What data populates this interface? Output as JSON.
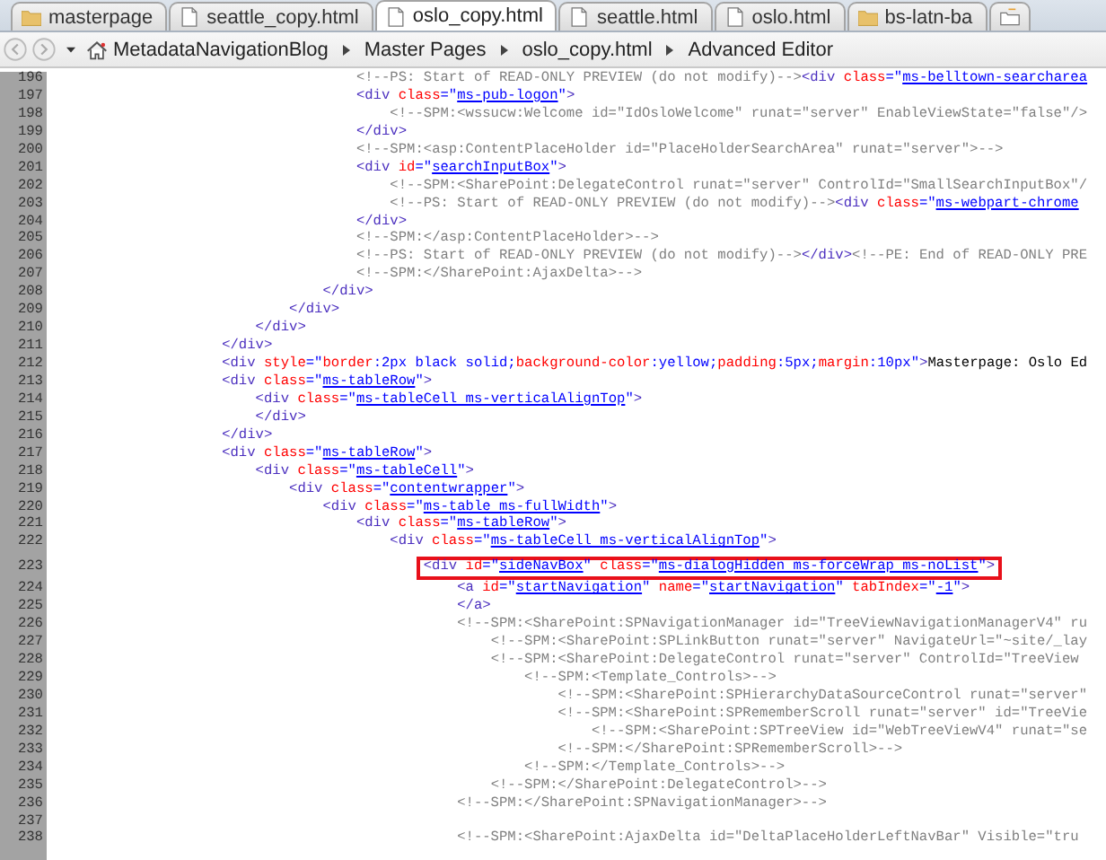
{
  "tabs": [
    {
      "label": "masterpage",
      "kind": "folder",
      "selected": false
    },
    {
      "label": "seattle_copy.html",
      "kind": "file",
      "selected": false
    },
    {
      "label": "oslo_copy.html",
      "kind": "file",
      "selected": true
    },
    {
      "label": "seattle.html",
      "kind": "file",
      "selected": false
    },
    {
      "label": "oslo.html",
      "kind": "file",
      "selected": false
    },
    {
      "label": "bs-latn-ba",
      "kind": "folder",
      "selected": false
    }
  ],
  "breadcrumb": [
    "MetadataNavigationBlog",
    "Master Pages",
    "oslo_copy.html",
    "Advanced Editor"
  ],
  "lines": [
    {
      "n": "196",
      "boxed": false,
      "code": [
        {
          "kind": "comment",
          "t": "                                    <!--PS: Start of READ-ONLY PREVIEW (do not modify)-->"
        },
        {
          "kind": "tag",
          "t": "<div"
        },
        {
          "kind": "attr",
          "t": " class"
        },
        {
          "kind": "punct",
          "t": "=\""
        },
        {
          "kind": "value",
          "t": "ms-belltown-searcharea"
        }
      ]
    },
    {
      "n": "197",
      "boxed": false,
      "code": [
        {
          "kind": "tag",
          "t": "                                    <div"
        },
        {
          "kind": "attr",
          "t": " class"
        },
        {
          "kind": "punct",
          "t": "=\""
        },
        {
          "kind": "value",
          "t": "ms-pub-logon"
        },
        {
          "kind": "punct",
          "t": "\""
        },
        {
          "kind": "tag",
          "t": ">"
        }
      ]
    },
    {
      "n": "198",
      "boxed": false,
      "code": [
        {
          "kind": "comment",
          "t": "                                        <!--SPM:<wssucw:Welcome id=\"IdOsloWelcome\" runat=\"server\" EnableViewState=\"false\"/>"
        }
      ]
    },
    {
      "n": "199",
      "boxed": false,
      "code": [
        {
          "kind": "tag",
          "t": "                                    </div>"
        }
      ]
    },
    {
      "n": "200",
      "boxed": false,
      "code": [
        {
          "kind": "comment",
          "t": "                                    <!--SPM:<asp:ContentPlaceHolder id=\"PlaceHolderSearchArea\" runat=\"server\">-->"
        }
      ]
    },
    {
      "n": "201",
      "boxed": false,
      "code": [
        {
          "kind": "tag",
          "t": "                                    <div"
        },
        {
          "kind": "attr",
          "t": " id"
        },
        {
          "kind": "punct",
          "t": "=\""
        },
        {
          "kind": "value",
          "t": "searchInputBox"
        },
        {
          "kind": "punct",
          "t": "\""
        },
        {
          "kind": "tag",
          "t": ">"
        }
      ]
    },
    {
      "n": "202",
      "boxed": false,
      "code": [
        {
          "kind": "comment",
          "t": "                                        <!--SPM:<SharePoint:DelegateControl runat=\"server\" ControlId=\"SmallSearchInputBox\"/"
        }
      ]
    },
    {
      "n": "203",
      "boxed": false,
      "code": [
        {
          "kind": "comment",
          "t": "                                        <!--PS: Start of READ-ONLY PREVIEW (do not modify)-->"
        },
        {
          "kind": "tag",
          "t": "<div"
        },
        {
          "kind": "attr",
          "t": " class"
        },
        {
          "kind": "punct",
          "t": "=\""
        },
        {
          "kind": "value",
          "t": "ms-webpart-chrome"
        }
      ]
    },
    {
      "n": "204",
      "boxed": false,
      "code": [
        {
          "kind": "tag",
          "t": "                                    </div>"
        }
      ]
    },
    {
      "n": "205",
      "boxed": false,
      "code": [
        {
          "kind": "comment",
          "t": "                                    <!--SPM:</asp:ContentPlaceHolder>-->"
        }
      ]
    },
    {
      "n": "206",
      "boxed": false,
      "code": [
        {
          "kind": "comment",
          "t": "                                    <!--PS: Start of READ-ONLY PREVIEW (do not modify)-->"
        },
        {
          "kind": "tag",
          "t": "</div>"
        },
        {
          "kind": "comment",
          "t": "<!--PE: End of READ-ONLY PRE"
        }
      ]
    },
    {
      "n": "207",
      "boxed": false,
      "code": [
        {
          "kind": "comment",
          "t": "                                    <!--SPM:</SharePoint:AjaxDelta>-->"
        }
      ]
    },
    {
      "n": "208",
      "boxed": false,
      "code": [
        {
          "kind": "tag",
          "t": "                                </div>"
        }
      ]
    },
    {
      "n": "209",
      "boxed": false,
      "code": [
        {
          "kind": "tag",
          "t": "                            </div>"
        }
      ]
    },
    {
      "n": "210",
      "boxed": false,
      "code": [
        {
          "kind": "tag",
          "t": "                        </div>"
        }
      ]
    },
    {
      "n": "211",
      "boxed": false,
      "code": [
        {
          "kind": "tag",
          "t": "                    </div>"
        }
      ]
    },
    {
      "n": "212",
      "boxed": false,
      "code": [
        {
          "kind": "tag",
          "t": "                    <div"
        },
        {
          "kind": "attr",
          "t": " style"
        },
        {
          "kind": "punct",
          "t": "=\""
        },
        {
          "kind": "property",
          "t": "border"
        },
        {
          "kind": "css",
          "t": ":2px black solid;"
        },
        {
          "kind": "property",
          "t": "background-color"
        },
        {
          "kind": "css",
          "t": ":yellow;"
        },
        {
          "kind": "property",
          "t": "padding"
        },
        {
          "kind": "css",
          "t": ":5px;"
        },
        {
          "kind": "property",
          "t": "margin"
        },
        {
          "kind": "css",
          "t": ":10px"
        },
        {
          "kind": "punct",
          "t": "\""
        },
        {
          "kind": "tag",
          "t": ">"
        },
        {
          "kind": "text",
          "t": "Masterpage: Oslo Ed"
        }
      ]
    },
    {
      "n": "213",
      "boxed": false,
      "code": [
        {
          "kind": "tag",
          "t": "                    <div"
        },
        {
          "kind": "attr",
          "t": " class"
        },
        {
          "kind": "punct",
          "t": "=\""
        },
        {
          "kind": "value",
          "t": "ms-tableRow"
        },
        {
          "kind": "punct",
          "t": "\""
        },
        {
          "kind": "tag",
          "t": ">"
        }
      ]
    },
    {
      "n": "214",
      "boxed": false,
      "code": [
        {
          "kind": "tag",
          "t": "                        <div"
        },
        {
          "kind": "attr",
          "t": " class"
        },
        {
          "kind": "punct",
          "t": "=\""
        },
        {
          "kind": "value",
          "t": "ms-tableCell ms-verticalAlignTop"
        },
        {
          "kind": "punct",
          "t": "\""
        },
        {
          "kind": "tag",
          "t": ">"
        }
      ]
    },
    {
      "n": "215",
      "boxed": false,
      "code": [
        {
          "kind": "tag",
          "t": "                        </div>"
        }
      ]
    },
    {
      "n": "216",
      "boxed": false,
      "code": [
        {
          "kind": "tag",
          "t": "                    </div>"
        }
      ]
    },
    {
      "n": "217",
      "boxed": false,
      "code": [
        {
          "kind": "tag",
          "t": "                    <div"
        },
        {
          "kind": "attr",
          "t": " class"
        },
        {
          "kind": "punct",
          "t": "=\""
        },
        {
          "kind": "value",
          "t": "ms-tableRow"
        },
        {
          "kind": "punct",
          "t": "\""
        },
        {
          "kind": "tag",
          "t": ">"
        }
      ]
    },
    {
      "n": "218",
      "boxed": false,
      "code": [
        {
          "kind": "tag",
          "t": "                        <div"
        },
        {
          "kind": "attr",
          "t": " class"
        },
        {
          "kind": "punct",
          "t": "=\""
        },
        {
          "kind": "value",
          "t": "ms-tableCell"
        },
        {
          "kind": "punct",
          "t": "\""
        },
        {
          "kind": "tag",
          "t": ">"
        }
      ]
    },
    {
      "n": "219",
      "boxed": false,
      "code": [
        {
          "kind": "tag",
          "t": "                            <div"
        },
        {
          "kind": "attr",
          "t": " class"
        },
        {
          "kind": "punct",
          "t": "=\""
        },
        {
          "kind": "value",
          "t": "contentwrapper"
        },
        {
          "kind": "punct",
          "t": "\""
        },
        {
          "kind": "tag",
          "t": ">"
        }
      ]
    },
    {
      "n": "220",
      "boxed": false,
      "code": [
        {
          "kind": "tag",
          "t": "                                <div"
        },
        {
          "kind": "attr",
          "t": " class"
        },
        {
          "kind": "punct",
          "t": "=\""
        },
        {
          "kind": "value",
          "t": "ms-table ms-fullWidth"
        },
        {
          "kind": "punct",
          "t": "\""
        },
        {
          "kind": "tag",
          "t": ">"
        }
      ]
    },
    {
      "n": "221",
      "boxed": false,
      "code": [
        {
          "kind": "tag",
          "t": "                                    <div"
        },
        {
          "kind": "attr",
          "t": " class"
        },
        {
          "kind": "punct",
          "t": "=\""
        },
        {
          "kind": "value",
          "t": "ms-tableRow"
        },
        {
          "kind": "punct",
          "t": "\""
        },
        {
          "kind": "tag",
          "t": ">"
        }
      ]
    },
    {
      "n": "222",
      "boxed": false,
      "code": [
        {
          "kind": "tag",
          "t": "                                        <div"
        },
        {
          "kind": "attr",
          "t": " class"
        },
        {
          "kind": "punct",
          "t": "=\""
        },
        {
          "kind": "value",
          "t": "ms-tableCell ms-verticalAlignTop"
        },
        {
          "kind": "punct",
          "t": "\""
        },
        {
          "kind": "tag",
          "t": ">"
        }
      ]
    },
    {
      "n": "223",
      "boxed": true,
      "code": [
        {
          "kind": "tag",
          "t": "                                            <div"
        },
        {
          "kind": "attr",
          "t": " id"
        },
        {
          "kind": "punct",
          "t": "=\""
        },
        {
          "kind": "value",
          "t": "sideNavBox"
        },
        {
          "kind": "punct",
          "t": "\""
        },
        {
          "kind": "attr",
          "t": " class"
        },
        {
          "kind": "punct",
          "t": "=\""
        },
        {
          "kind": "value",
          "t": "ms-dialogHidden ms-forceWrap ms-noList"
        },
        {
          "kind": "punct",
          "t": "\""
        },
        {
          "kind": "tag",
          "t": ">"
        }
      ]
    },
    {
      "n": "224",
      "boxed": false,
      "code": [
        {
          "kind": "tag",
          "t": "                                                <a"
        },
        {
          "kind": "attr",
          "t": " id"
        },
        {
          "kind": "punct",
          "t": "=\""
        },
        {
          "kind": "value",
          "t": "startNavigation"
        },
        {
          "kind": "punct",
          "t": "\""
        },
        {
          "kind": "attr",
          "t": " name"
        },
        {
          "kind": "punct",
          "t": "=\""
        },
        {
          "kind": "value",
          "t": "startNavigation"
        },
        {
          "kind": "punct",
          "t": "\""
        },
        {
          "kind": "attr",
          "t": " tabIndex"
        },
        {
          "kind": "punct",
          "t": "=\""
        },
        {
          "kind": "value",
          "t": "-1"
        },
        {
          "kind": "punct",
          "t": "\""
        },
        {
          "kind": "tag",
          "t": ">"
        }
      ]
    },
    {
      "n": "225",
      "boxed": false,
      "code": [
        {
          "kind": "tag",
          "t": "                                                </a>"
        }
      ]
    },
    {
      "n": "226",
      "boxed": false,
      "code": [
        {
          "kind": "comment",
          "t": "                                                <!--SPM:<SharePoint:SPNavigationManager id=\"TreeViewNavigationManagerV4\" ru"
        }
      ]
    },
    {
      "n": "227",
      "boxed": false,
      "code": [
        {
          "kind": "comment",
          "t": "                                                    <!--SPM:<SharePoint:SPLinkButton runat=\"server\" NavigateUrl=\"~site/_lay"
        }
      ]
    },
    {
      "n": "228",
      "boxed": false,
      "code": [
        {
          "kind": "comment",
          "t": "                                                    <!--SPM:<SharePoint:DelegateControl runat=\"server\" ControlId=\"TreeView"
        }
      ]
    },
    {
      "n": "229",
      "boxed": false,
      "code": [
        {
          "kind": "comment",
          "t": "                                                        <!--SPM:<Template_Controls>-->"
        }
      ]
    },
    {
      "n": "230",
      "boxed": false,
      "code": [
        {
          "kind": "comment",
          "t": "                                                            <!--SPM:<SharePoint:SPHierarchyDataSourceControl runat=\"server\""
        }
      ]
    },
    {
      "n": "231",
      "boxed": false,
      "code": [
        {
          "kind": "comment",
          "t": "                                                            <!--SPM:<SharePoint:SPRememberScroll runat=\"server\" id=\"TreeVie"
        }
      ]
    },
    {
      "n": "232",
      "boxed": false,
      "code": [
        {
          "kind": "comment",
          "t": "                                                                <!--SPM:<SharePoint:SPTreeView id=\"WebTreeViewV4\" runat=\"se"
        }
      ]
    },
    {
      "n": "233",
      "boxed": false,
      "code": [
        {
          "kind": "comment",
          "t": "                                                            <!--SPM:</SharePoint:SPRememberScroll>-->"
        }
      ]
    },
    {
      "n": "234",
      "boxed": false,
      "code": [
        {
          "kind": "comment",
          "t": "                                                        <!--SPM:</Template_Controls>-->"
        }
      ]
    },
    {
      "n": "235",
      "boxed": false,
      "code": [
        {
          "kind": "comment",
          "t": "                                                    <!--SPM:</SharePoint:DelegateControl>-->"
        }
      ]
    },
    {
      "n": "236",
      "boxed": false,
      "code": [
        {
          "kind": "comment",
          "t": "                                                <!--SPM:</SharePoint:SPNavigationManager>-->"
        }
      ]
    },
    {
      "n": "237",
      "boxed": false
    },
    {
      "n": "238",
      "boxed": false,
      "code": [
        {
          "kind": "comment",
          "t": "                                                <!--SPM:<SharePoint:AjaxDelta id=\"DeltaPlaceHolderLeftNavBar\" Visible=\"tru"
        }
      ]
    }
  ]
}
